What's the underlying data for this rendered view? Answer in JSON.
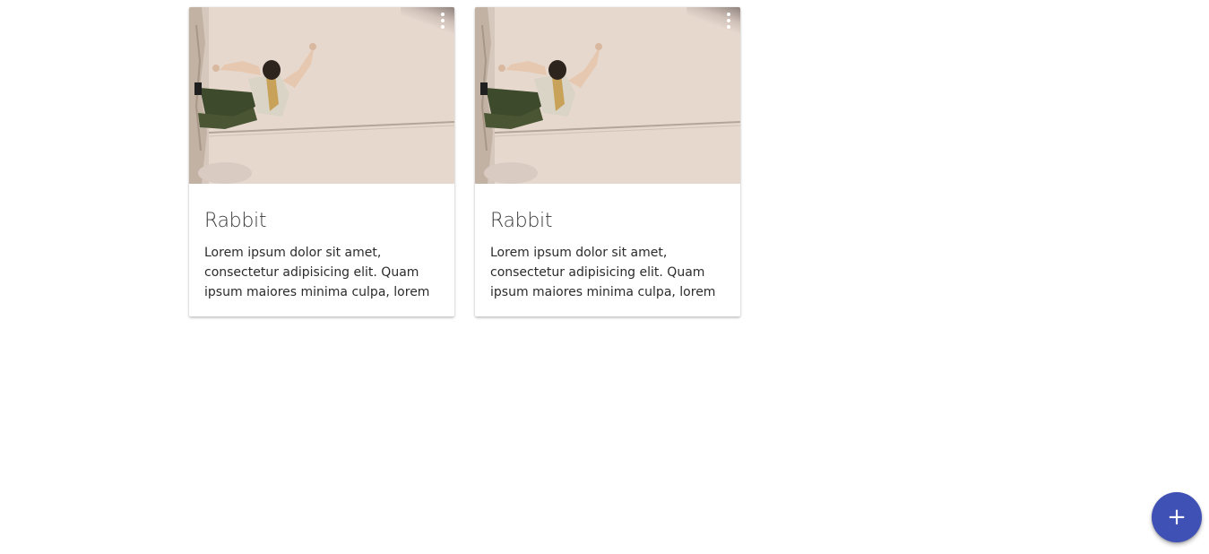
{
  "cards": [
    {
      "title": "Rabbit",
      "text": "Lorem ipsum dolor sit amet, consectetur adipisicing elit. Quam ipsum maiores minima culpa, lorem"
    },
    {
      "title": "Rabbit",
      "text": "Lorem ipsum dolor sit amet, consectetur adipisicing elit. Quam ipsum maiores minima culpa, lorem"
    }
  ],
  "fab": {
    "label": "+"
  },
  "colors": {
    "accent": "#3f51b5",
    "card_bg": "#ffffff",
    "photo_bg": "#e6d7cd"
  },
  "icons": {
    "card_menu": "more-vert-icon",
    "fab": "add-icon"
  }
}
